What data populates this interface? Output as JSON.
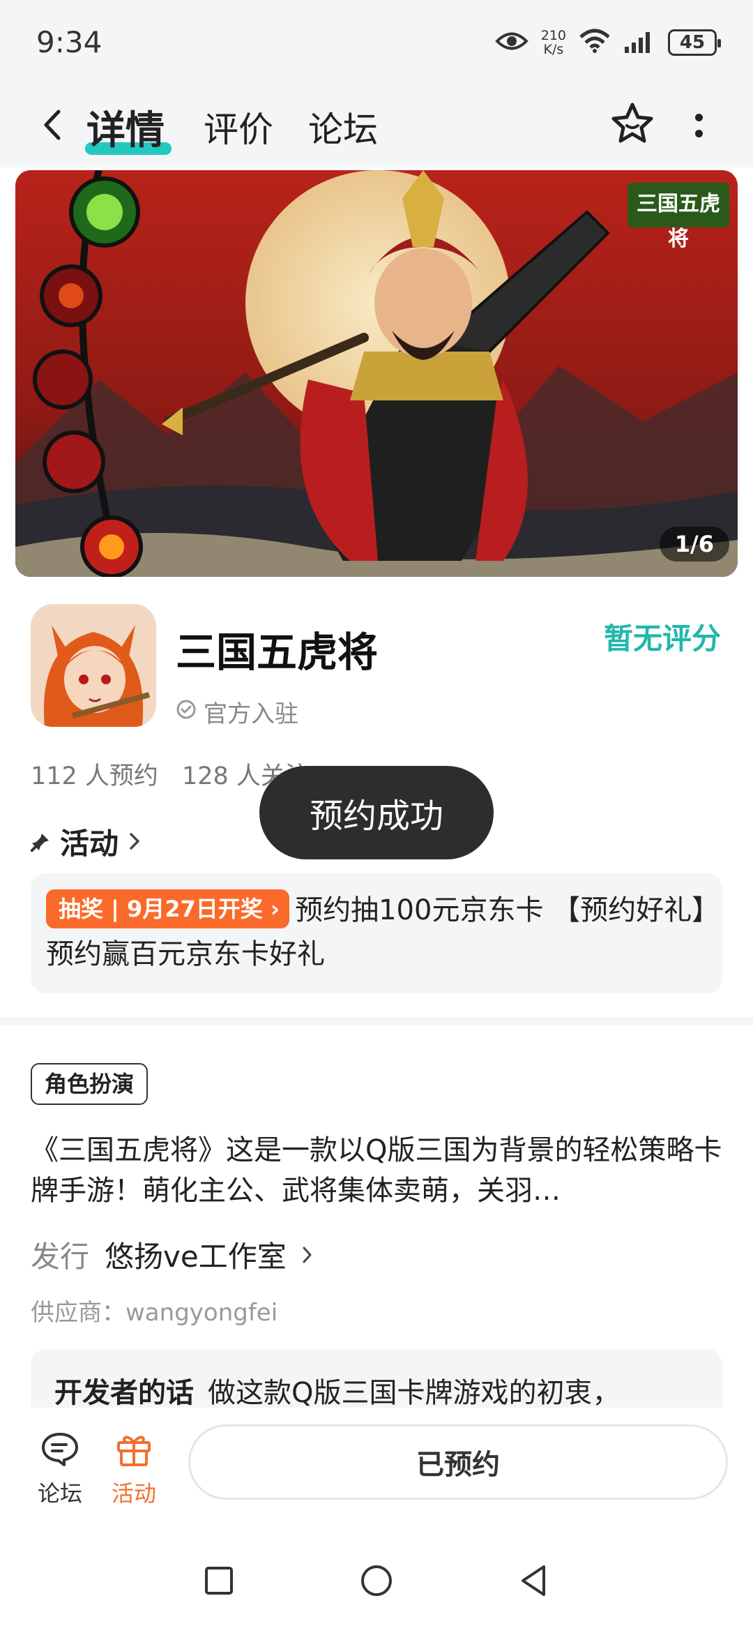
{
  "status_bar": {
    "time": "9:34",
    "net_speed_value": "210",
    "net_speed_unit": "K/s",
    "battery": "45",
    "icons": [
      "eye-icon",
      "wifi-icon",
      "signal-icon",
      "battery-icon"
    ]
  },
  "nav": {
    "tabs": [
      {
        "label": "详情",
        "active": true
      },
      {
        "label": "评价",
        "active": false
      },
      {
        "label": "论坛",
        "active": false
      }
    ],
    "accent_color": "#24c8c0"
  },
  "banner": {
    "counter": "1/6",
    "logo_text": "三国五虎将"
  },
  "app": {
    "name": "三国五虎将",
    "rating": "暂无评分",
    "official": "官方入驻",
    "reservations": "112 人预约",
    "followers": "128 人关注"
  },
  "toast": "预约成功",
  "activity": {
    "title": "活动",
    "badge": "抽奖 | 9月27日开奖",
    "text": "预约抽100元京东卡 【预约好礼】预约赢百元京东卡好礼",
    "badge_color": "#fa6a2a"
  },
  "detail": {
    "genre": "角色扮演",
    "description": "《三国五虎将》这是一款以Q版三国为背景的轻松策略卡牌手游！萌化主公、武将集体卖萌，关羽…",
    "publisher_label": "发行",
    "publisher": "悠扬ve工作室",
    "supplier": "供应商：wangyongfei",
    "dev_label": "开发者的话",
    "dev_text": "做这款Q版三国卡牌游戏的初衷，"
  },
  "bottom_bar": {
    "forum": "论坛",
    "activity": "活动",
    "reserved": "已预约",
    "active_color": "#f07030"
  }
}
